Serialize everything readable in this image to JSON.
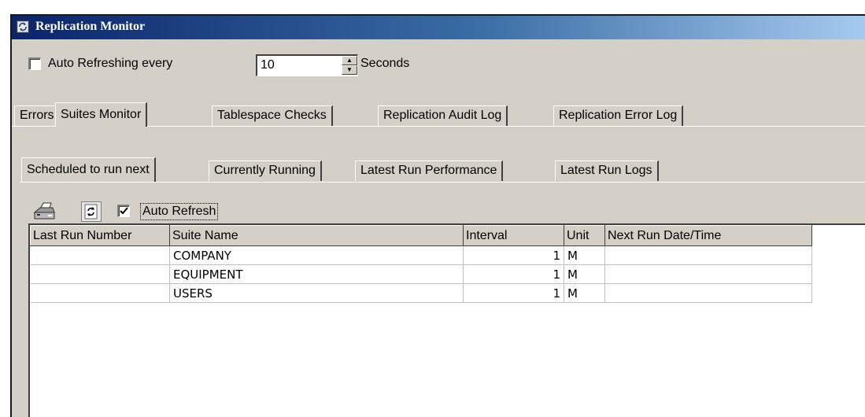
{
  "window": {
    "title": "Replication Monitor",
    "icon": "replication-app-icon"
  },
  "auto_refresh_every": {
    "label": "Auto Refreshing every",
    "checked": false,
    "value": "10",
    "unit_label": "Seconds"
  },
  "main_tabs": [
    {
      "label": "Errors",
      "active": false
    },
    {
      "label": "Suites Monitor",
      "active": true
    },
    {
      "label": "Tablespace Checks",
      "active": false
    },
    {
      "label": "Replication Audit Log",
      "active": false
    },
    {
      "label": "Replication Error Log",
      "active": false
    }
  ],
  "sub_tabs": [
    {
      "label": "Scheduled to run next",
      "active": true
    },
    {
      "label": "Currently Running",
      "active": false
    },
    {
      "label": "Latest Run Performance",
      "active": false
    },
    {
      "label": "Latest Run Logs",
      "active": false
    }
  ],
  "toolbar": {
    "print_icon": "printer-icon",
    "refresh_icon": "refresh-icon",
    "auto_refresh_label": "Auto Refresh",
    "auto_refresh_checked": true
  },
  "grid": {
    "columns": [
      "Last Run Number",
      "Suite Name",
      "Interval",
      "Unit",
      "Next Run Date/Time"
    ],
    "rows": [
      {
        "last_run_number": "",
        "suite_name": "COMPANY",
        "interval": "1",
        "unit": "M",
        "next_run": ""
      },
      {
        "last_run_number": "",
        "suite_name": "EQUIPMENT",
        "interval": "1",
        "unit": "M",
        "next_run": ""
      },
      {
        "last_run_number": "",
        "suite_name": "USERS",
        "interval": "1",
        "unit": "M",
        "next_run": ""
      }
    ]
  },
  "colors": {
    "title_bar_start": "#0a246a",
    "title_bar_end": "#a6caf0",
    "face": "#d4d0c8"
  }
}
